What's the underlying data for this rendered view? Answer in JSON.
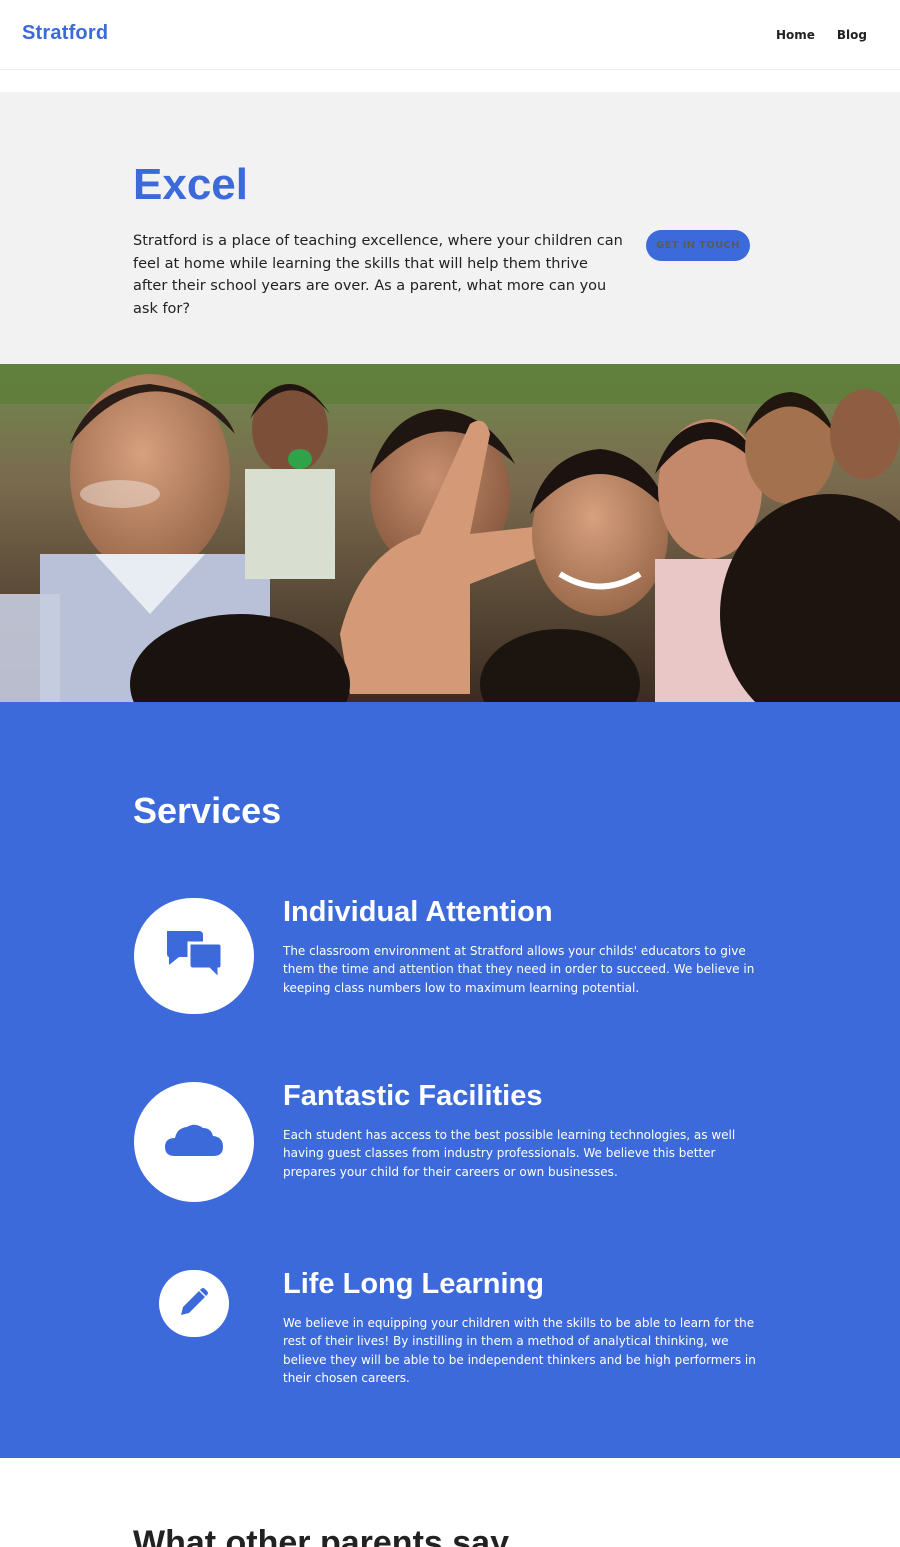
{
  "header": {
    "logo": "Stratford",
    "nav": [
      {
        "label": "Home"
      },
      {
        "label": "Blog"
      }
    ]
  },
  "hero": {
    "title": "Excel",
    "text": "Stratford is a place of teaching excellence, where your children can feel at home while learning the skills that will help them thrive after their school years are over. As a parent, what more can you ask for?",
    "cta": "GET IN TOUCH"
  },
  "services": {
    "title": "Services",
    "items": [
      {
        "title": "Individual Attention",
        "desc": "The classroom environment at Stratford allows your childs' educators to give them the time and attention that they need in order to succeed. We believe in keeping class numbers low to maximum learning potential.",
        "icon": "chat-bubbles-icon"
      },
      {
        "title": "Fantastic Facilities",
        "desc": "Each student has access to the best possible learning technologies, as well having guest classes from industry professionals. We believe this better prepares your child for their careers or own businesses.",
        "icon": "cloud-icon"
      },
      {
        "title": "Life Long Learning",
        "desc": "We believe in equipping your children with the skills to be able to learn for the rest of their lives! By instilling in them a method of analytical thinking, we believe they will be able to be independent thinkers and be high performers in their chosen careers.",
        "icon": "pencil-icon"
      }
    ]
  },
  "testimonials": {
    "title": "What other parents say"
  },
  "colors": {
    "accent": "#3d6adb",
    "hero_bg": "#f2f2f2",
    "text": "#222222"
  }
}
